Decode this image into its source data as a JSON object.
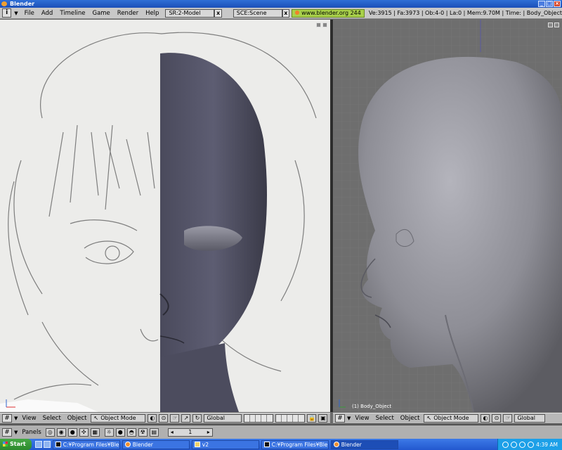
{
  "window": {
    "title": "Blender"
  },
  "menu": {
    "info_glyph": "i",
    "items": [
      "File",
      "Add",
      "Timeline",
      "Game",
      "Render",
      "Help"
    ],
    "screen_field": "SR:2-Model",
    "scene_field": "SCE:Scene",
    "close_glyph": "x",
    "website": "www.blender.org 244",
    "stats": "Ve:3915 | Fa:3973 | Ob:4-0 | La:0 | Mem:9.70M | Time: | Body_Object"
  },
  "right_viewport": {
    "object_label": "(1) Body_Object"
  },
  "left_header": {
    "view": "View",
    "select": "Select",
    "object": "Object",
    "mode": "Object Mode",
    "orientation": "Global"
  },
  "right_header": {
    "view": "View",
    "select": "Select",
    "object": "Object",
    "mode": "Object Mode",
    "orientation": "Global"
  },
  "panels_bar": {
    "label": "Panels",
    "frame": "1"
  },
  "taskbar": {
    "start": "Start",
    "tasks": [
      {
        "label": "C:¥Program Files¥Blende...",
        "icon": "console-icon"
      },
      {
        "label": "Blender",
        "icon": "blender-icon"
      },
      {
        "label": "v2",
        "icon": "folder-icon"
      },
      {
        "label": "C:¥Program Files¥Blende...",
        "icon": "console-icon"
      },
      {
        "label": "Blender",
        "icon": "blender-icon"
      }
    ],
    "clock": "4:39 AM"
  },
  "colors": {
    "title_blue": "#1b4fb8",
    "header_gray": "#b8b8b8",
    "viewport_gray": "#6e6e6e",
    "website_green": "#a8d04a",
    "taskbar_blue": "#2358cf"
  }
}
